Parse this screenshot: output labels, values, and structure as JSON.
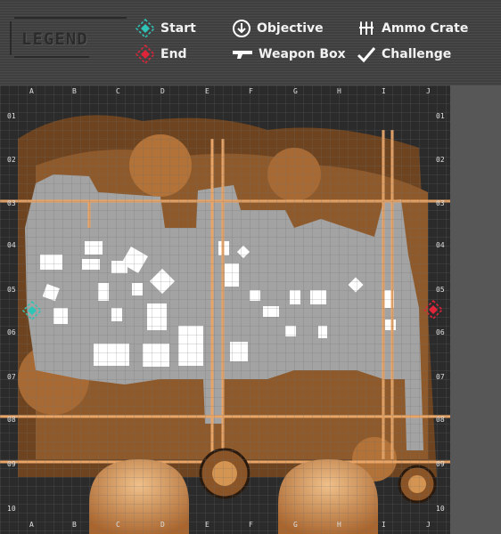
{
  "legend": {
    "title": "LEGEND",
    "items": [
      {
        "key": "start",
        "label": "Start",
        "icon": "start-diamond-icon",
        "color": "#2ec4b6"
      },
      {
        "key": "objective",
        "label": "Objective",
        "icon": "objective-arrow-icon",
        "color": "#ffffff"
      },
      {
        "key": "ammo",
        "label": "Ammo Crate",
        "icon": "ammo-crate-icon",
        "color": "#ffffff"
      },
      {
        "key": "end",
        "label": "End",
        "icon": "end-diamond-icon",
        "color": "#e0243a"
      },
      {
        "key": "weapon",
        "label": "Weapon Box",
        "icon": "weapon-box-icon",
        "color": "#ffffff"
      },
      {
        "key": "challenge",
        "label": "Challenge",
        "icon": "challenge-check-icon",
        "color": "#ffffff"
      }
    ]
  },
  "map": {
    "columns": [
      "A",
      "B",
      "C",
      "D",
      "E",
      "F",
      "G",
      "H",
      "I",
      "J"
    ],
    "rows": [
      "01",
      "02",
      "03",
      "04",
      "05",
      "06",
      "07",
      "08",
      "09",
      "10"
    ],
    "colors": {
      "terrain": "#b5733a",
      "terrain_dark": "#2a1a0e",
      "walkable": "#a8a8a8",
      "building": "#ffffff",
      "pipe": "#e8a567",
      "grid": "#7a7a7a"
    }
  }
}
